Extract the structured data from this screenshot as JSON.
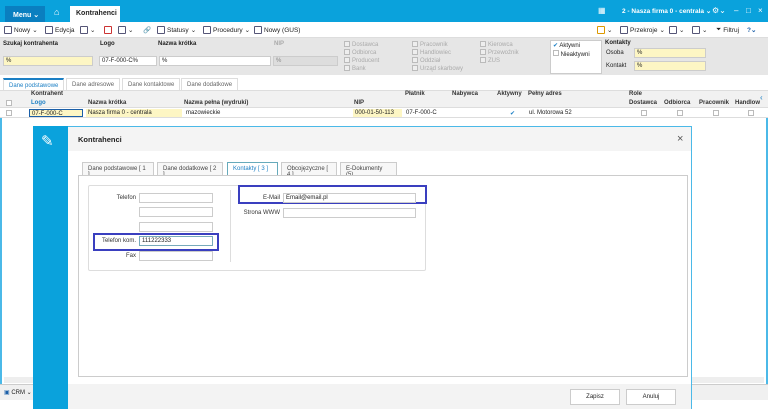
{
  "titlebar": {
    "menu": "Menu ⌄",
    "tab": "Kontrahenci",
    "firm": "2 - Nasza firma 0 - centrala ⌄",
    "icons": [
      "home-icon",
      "grid-icon",
      "gear-icon",
      "minimize-icon",
      "maximize-icon",
      "close-icon"
    ]
  },
  "toolbar": {
    "new": "Nowy",
    "edit": "Edycja",
    "statuses": "Statusy",
    "procedures": "Procedury",
    "new_gus": "Nowy (GUS)",
    "views": "Przekroje",
    "filter": "Filtruj"
  },
  "filters": {
    "search_label": "Szukaj kontrahenta",
    "search_value": "%",
    "logo_label": "Logo",
    "logo_value": "07-F-000-C%",
    "short_label": "Nazwa krótka",
    "short_value": "%",
    "nip_label": "NIP",
    "nip_value": "%",
    "roles_col1": [
      "Dostawca",
      "Odbiorca",
      "Producent",
      "Bank"
    ],
    "roles_col2": [
      "Pracownik",
      "Handlowiec",
      "Oddział",
      "Urząd skarbowy"
    ],
    "roles_col3": [
      "Kierowca",
      "Przewoźnik",
      "ZUS"
    ],
    "active": "Aktywni",
    "inactive": "Nieaktywni",
    "contacts_label": "Kontakty",
    "person_label": "Osoba",
    "person_value": "%",
    "contact_label": "Kontakt",
    "contact_value": "%"
  },
  "grid": {
    "tabs": [
      "Dane podstawowe",
      "Dane adresowe",
      "Dane kontaktowe",
      "Dane dodatkowe"
    ],
    "group_header": "Kontrahent",
    "roles_header": "Role",
    "columns": {
      "logo": "Logo",
      "short": "Nazwa krótka",
      "full": "Nazwa pełna (wydruki)",
      "nip": "NIP",
      "payer": "Płatnik",
      "buyer": "Nabywca",
      "active": "Aktywny",
      "address": "Pełny adres",
      "supplier": "Dostawca",
      "recipient": "Odbiorca",
      "employee": "Pracownik",
      "salesman": "Handlow"
    },
    "row": {
      "logo": "07-F-000-C",
      "short": "Nasza firma 0 - centrala",
      "full": "mazowieckie",
      "nip": "000-01-50-113",
      "payer": "07-F-000-C",
      "active": true,
      "address": "ul. Motorowa 52"
    }
  },
  "status": {
    "crm": "CRM ⌄"
  },
  "modal": {
    "title": "Kontrahenci",
    "tabs": [
      "Dane podstawowe [ 1 ]",
      "Dane dodatkowe [ 2 ]",
      "Kontakty [ 3 ]",
      "Obcojęzyczne [ 4 ]",
      "E-Dokumenty (5)"
    ],
    "phone_label": "Telefon",
    "mobile_label": "Telefon kom.",
    "mobile_value": "111222333",
    "fax_label": "Fax",
    "email_label": "E-Mail",
    "email_value": "Email@email.pl",
    "www_label": "Strona WWW",
    "save": "Zapisz",
    "cancel": "Anuluj"
  }
}
